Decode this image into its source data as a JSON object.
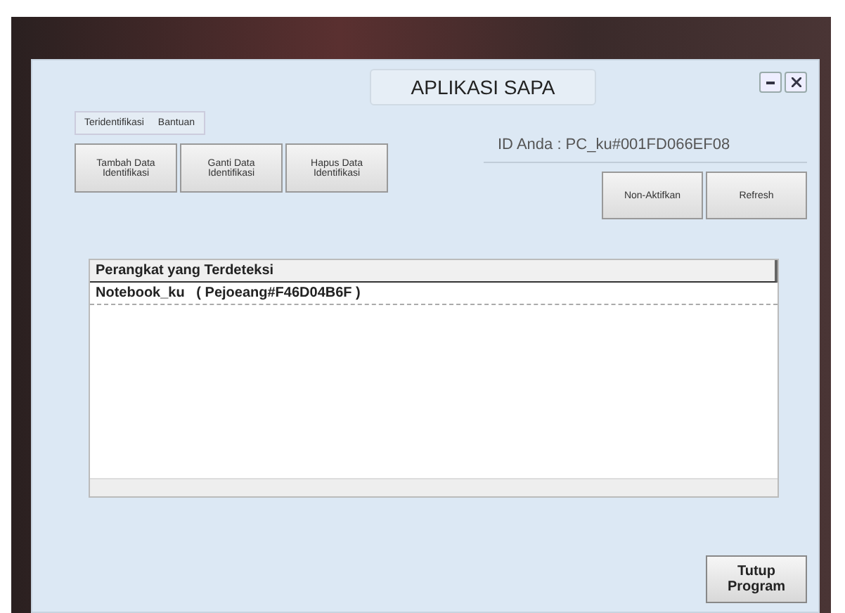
{
  "window": {
    "title": "APLIKASI SAPA"
  },
  "menu": [
    {
      "label": "Teridentifikasi"
    },
    {
      "label": "Bantuan"
    }
  ],
  "left_buttons": [
    {
      "label": "Tambah Data Identifikasi"
    },
    {
      "label": "Ganti Data Identifikasi"
    },
    {
      "label": "Hapus Data Identifikasi"
    }
  ],
  "id_label": "ID Anda : PC_ku#001FD066EF08",
  "right_buttons": [
    {
      "label": "Non-Aktifkan"
    },
    {
      "label": "Refresh"
    }
  ],
  "device_list": {
    "header": "Perangkat yang Terdeteksi",
    "rows": [
      "Notebook_ku   ( Pejoeang#F46D04B6F )"
    ]
  },
  "close_button": "Tutup Program"
}
